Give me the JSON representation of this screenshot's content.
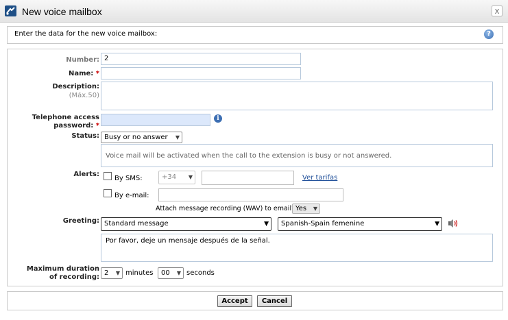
{
  "window": {
    "title": "New voice mailbox",
    "close_glyph": "x"
  },
  "header": {
    "instruction": "Enter the data for the new voice mailbox:",
    "help_glyph": "?"
  },
  "form": {
    "number": {
      "label": "Number:",
      "value": "2"
    },
    "name": {
      "label": "Name:",
      "required_mark": "*",
      "value": ""
    },
    "description": {
      "label": "Description:",
      "hint": "(Máx.50)",
      "value": ""
    },
    "password": {
      "label_line1": "Telephone access",
      "label_line2": "password:",
      "required_mark": "*",
      "value": "",
      "info_glyph": "i"
    },
    "status": {
      "label": "Status:",
      "selected": "Busy or no answer",
      "help_text": "Voice mail will be activated when the call to the extension is busy or not answered."
    },
    "alerts": {
      "label": "Alerts:",
      "sms": {
        "label": "By SMS:",
        "country_code": "+34",
        "phone": "",
        "link": "Ver tarifas"
      },
      "email": {
        "label": "By e-mail:",
        "value": ""
      },
      "attach_label": "Attach message recording (WAV) to email?",
      "attach_value": "Yes"
    },
    "greeting": {
      "label": "Greeting:",
      "type": "Standard message",
      "voice": "Spanish-Spain femenine",
      "text": "Por favor, deje un mensaje después de la señal."
    },
    "duration": {
      "label_line1": "Maximum duration",
      "label_line2": "of recording:",
      "minutes": "2",
      "minutes_label": "minutes",
      "seconds": "00",
      "seconds_label": "seconds"
    }
  },
  "buttons": {
    "accept": "Accept",
    "cancel": "Cancel"
  },
  "colors": {
    "required": "#cc0000",
    "link": "#1f4f99",
    "field_border": "#b6c8dc",
    "password_bg": "#dce8fb"
  },
  "icons": [
    "app-icon",
    "close-icon",
    "help-icon",
    "info-icon",
    "dropdown-caret-icon",
    "speaker-icon"
  ]
}
